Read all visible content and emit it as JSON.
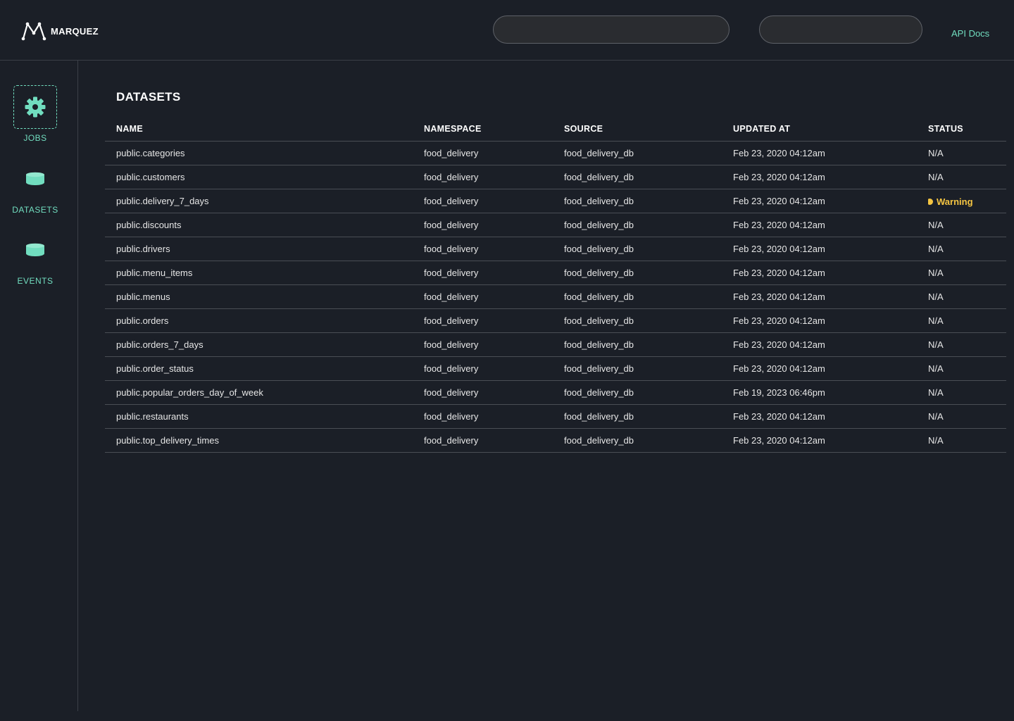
{
  "header": {
    "logo_text": "MARQUEZ",
    "search_primary_placeholder": "",
    "search_secondary_placeholder": "",
    "api_docs_label": "API Docs"
  },
  "sidebar": {
    "items": [
      {
        "label": "JOBS",
        "icon": "gear-icon",
        "active": true
      },
      {
        "label": "DATASETS",
        "icon": "database-icon",
        "active": false
      },
      {
        "label": "EVENTS",
        "icon": "database-icon",
        "active": false
      }
    ]
  },
  "main": {
    "title": "DATASETS",
    "columns": [
      "NAME",
      "NAMESPACE",
      "SOURCE",
      "UPDATED AT",
      "STATUS"
    ],
    "rows": [
      {
        "name": "public.categories",
        "namespace": "food_delivery",
        "source": "food_delivery_db",
        "updated_at": "Feb 23, 2020 04:12am",
        "status": "N/A"
      },
      {
        "name": "public.customers",
        "namespace": "food_delivery",
        "source": "food_delivery_db",
        "updated_at": "Feb 23, 2020 04:12am",
        "status": "N/A"
      },
      {
        "name": "public.delivery_7_days",
        "namespace": "food_delivery",
        "source": "food_delivery_db",
        "updated_at": "Feb 23, 2020 04:12am",
        "status": "Warning"
      },
      {
        "name": "public.discounts",
        "namespace": "food_delivery",
        "source": "food_delivery_db",
        "updated_at": "Feb 23, 2020 04:12am",
        "status": "N/A"
      },
      {
        "name": "public.drivers",
        "namespace": "food_delivery",
        "source": "food_delivery_db",
        "updated_at": "Feb 23, 2020 04:12am",
        "status": "N/A"
      },
      {
        "name": "public.menu_items",
        "namespace": "food_delivery",
        "source": "food_delivery_db",
        "updated_at": "Feb 23, 2020 04:12am",
        "status": "N/A"
      },
      {
        "name": "public.menus",
        "namespace": "food_delivery",
        "source": "food_delivery_db",
        "updated_at": "Feb 23, 2020 04:12am",
        "status": "N/A"
      },
      {
        "name": "public.orders",
        "namespace": "food_delivery",
        "source": "food_delivery_db",
        "updated_at": "Feb 23, 2020 04:12am",
        "status": "N/A"
      },
      {
        "name": "public.orders_7_days",
        "namespace": "food_delivery",
        "source": "food_delivery_db",
        "updated_at": "Feb 23, 2020 04:12am",
        "status": "N/A"
      },
      {
        "name": "public.order_status",
        "namespace": "food_delivery",
        "source": "food_delivery_db",
        "updated_at": "Feb 23, 2020 04:12am",
        "status": "N/A"
      },
      {
        "name": "public.popular_orders_day_of_week",
        "namespace": "food_delivery",
        "source": "food_delivery_db",
        "updated_at": "Feb 19, 2023 06:46pm",
        "status": "N/A"
      },
      {
        "name": "public.restaurants",
        "namespace": "food_delivery",
        "source": "food_delivery_db",
        "updated_at": "Feb 23, 2020 04:12am",
        "status": "N/A"
      },
      {
        "name": "public.top_delivery_times",
        "namespace": "food_delivery",
        "source": "food_delivery_db",
        "updated_at": "Feb 23, 2020 04:12am",
        "status": "N/A"
      }
    ]
  },
  "colors": {
    "background": "#1b1f27",
    "accent": "#71ddbf",
    "warning": "#f5c542",
    "divider": "#4a4e55"
  }
}
